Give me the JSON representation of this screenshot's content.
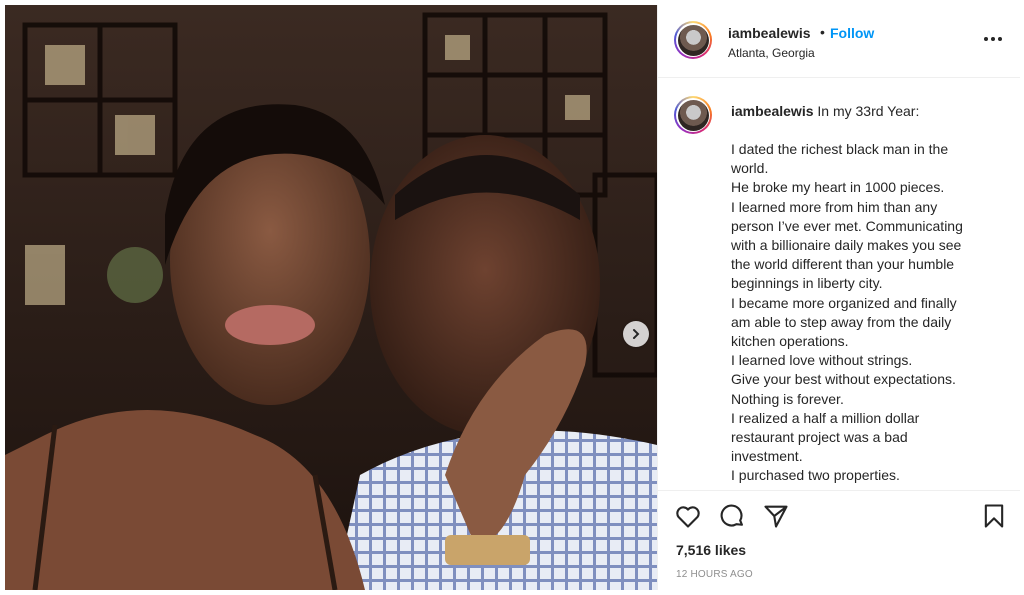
{
  "post": {
    "username": "iambealewis",
    "follow_dot": "•",
    "follow_label": "Follow",
    "location": "Atlanta, Georgia",
    "more_icon": "more-horizontal-icon",
    "caption_intro": "In my 33rd Year:",
    "caption_lines": [
      "I dated the richest black man in the",
      "world.",
      "He broke my heart in 1000 pieces.",
      "I learned more from him than any",
      "person I’ve ever met. Communicating",
      "with a billionaire daily makes you see",
      "the world different than your humble",
      "beginnings in liberty city.",
      "I became more organized and finally",
      "am able to step away from the daily",
      "kitchen operations.",
      "I learned love without strings.",
      "Give your best without expectations.",
      "Nothing is forever.",
      "I realized a half a million dollar",
      "restaurant project was a bad",
      "investment.",
      "I purchased two properties."
    ],
    "likes": "7,516 likes",
    "time_ago": "12 HOURS AGO",
    "icons": [
      "heart-icon",
      "comment-icon",
      "share-icon",
      "bookmark-icon",
      "chevron-right-icon"
    ]
  }
}
